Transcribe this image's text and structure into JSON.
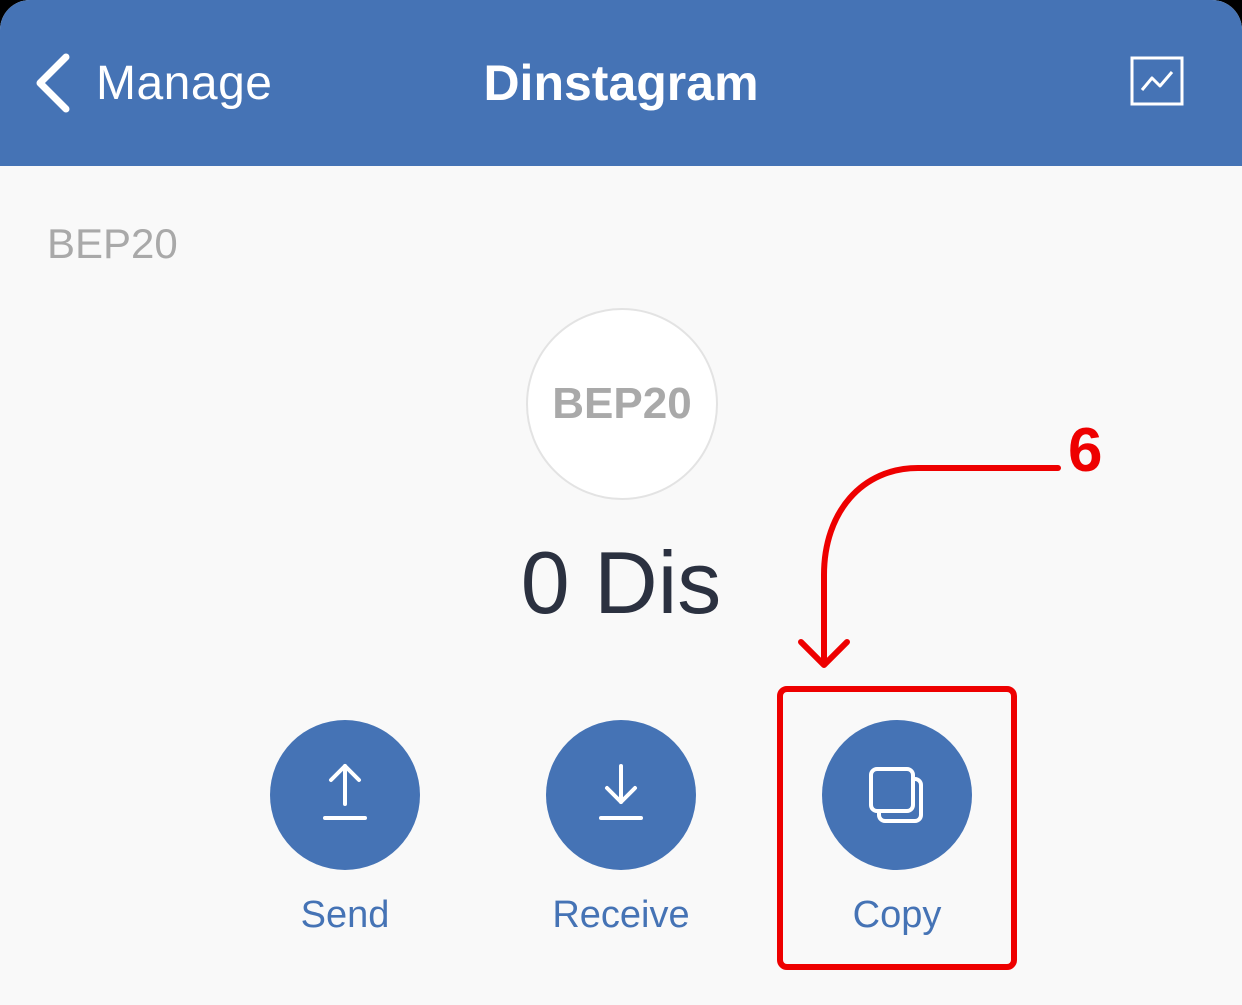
{
  "nav": {
    "back_label": "Manage",
    "title": "Dinstagram",
    "back_icon": "chevron-left-icon",
    "chart_icon": "chart-icon"
  },
  "token": {
    "network": "BEP20",
    "avatar_text": "BEP20",
    "balance": "0 Dis"
  },
  "actions": [
    {
      "label": "Send",
      "icon": "upload-arrow-icon"
    },
    {
      "label": "Receive",
      "icon": "download-arrow-icon"
    },
    {
      "label": "Copy",
      "icon": "copy-icon"
    }
  ],
  "annotation": {
    "step": "6"
  },
  "colors": {
    "primary": "#4573b5",
    "background": "#f9f9f9",
    "balance_text": "#2b3140",
    "muted_text": "#a9a9a9",
    "annotation": "#ee0000"
  }
}
